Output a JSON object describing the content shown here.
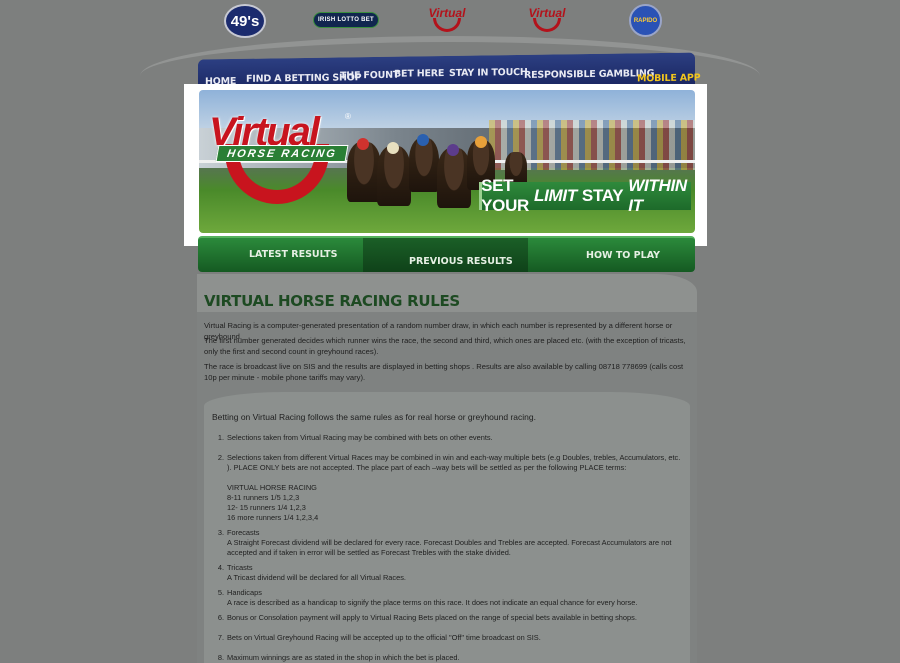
{
  "logos": {
    "l49": "49's",
    "irish_lotto_bet": "IRISH LOTTO BET",
    "vhr": "Virtual",
    "vgr": "Virtual",
    "rapido": "RAPIDO"
  },
  "nav": {
    "items": [
      "HOME",
      "FIND A BETTING SHOP",
      "THE FOUNT",
      "BET HERE",
      "STAY IN TOUCH",
      "RESPONSIBLE GAMBLING",
      "MOBILE APP"
    ]
  },
  "hero": {
    "brand_word": "Virtual",
    "brand_sub": "HORSE RACING",
    "slogan_a": "SET YOUR",
    "slogan_b": "LIMIT",
    "slogan_c": "STAY",
    "slogan_d": "WITHIN IT"
  },
  "subnav": {
    "items": [
      "LATEST RESULTS",
      "PREVIOUS RESULTS",
      "HOW TO PLAY"
    ]
  },
  "page": {
    "title": "VIRTUAL HORSE RACING RULES",
    "p1": "Virtual Racing is a computer-generated presentation of a random number draw, in which each number is represented by a different horse or greyhound.",
    "p2": "The first number generated decides which runner wins the race, the second and third, which ones are placed etc. (with the exception of tricasts, only the first and second count in greyhound races).",
    "p3": "The race is broadcast live on SIS and the results are displayed in betting shops . Results are also available by calling 08718 778699 (calls cost 10p per minute - mobile phone tariffs may vary)."
  },
  "rules": {
    "intro": "Betting on Virtual Racing follows the same rules as for real horse or greyhound racing.",
    "items": [
      {
        "num": "1.",
        "lines": [
          "Selections taken from Virtual Racing may be combined with bets on other events."
        ]
      },
      {
        "num": "2.",
        "lines": [
          "Selections taken from different Virtual Races may be combined in win and each-way multiple bets (e.g Doubles, trebles, Accumulators, etc. ). PLACE ONLY bets are not accepted. The place part of each –way bets will be settled as per the following PLACE terms:",
          "",
          "VIRTUAL HORSE RACING",
          "8-11 runners 1/5 1,2,3",
          "12- 15 runners 1/4 1,2,3",
          "16 more runners 1/4 1,2,3,4"
        ]
      },
      {
        "num": "3.",
        "lines": [
          "Forecasts",
          "A Straight Forecast dividend will be declared for every race. Forecast Doubles and Trebles are accepted. Forecast Accumulators are not accepted and if taken in error will be settled as Forecast Trebles with the stake divided."
        ]
      },
      {
        "num": "4.",
        "lines": [
          "Tricasts",
          "A Tricast dividend will be declared for all Virtual Races."
        ]
      },
      {
        "num": "5.",
        "lines": [
          "Handicaps",
          "A race is described as a handicap to signify the place terms on this race. It does not indicate an equal chance for every horse."
        ]
      },
      {
        "num": "6.",
        "lines": [
          "Bonus or Consolation payment will apply to Virtual Racing Bets placed on the range of special bets available in betting shops."
        ]
      },
      {
        "num": "7.",
        "lines": [
          "Bets on Virtual Greyhound Racing will be accepted up to the official \"Off\" time broadcast on SIS."
        ]
      },
      {
        "num": "8.",
        "lines": [
          "Maximum winnings are as stated in the shop in which the bet is placed."
        ]
      }
    ]
  }
}
